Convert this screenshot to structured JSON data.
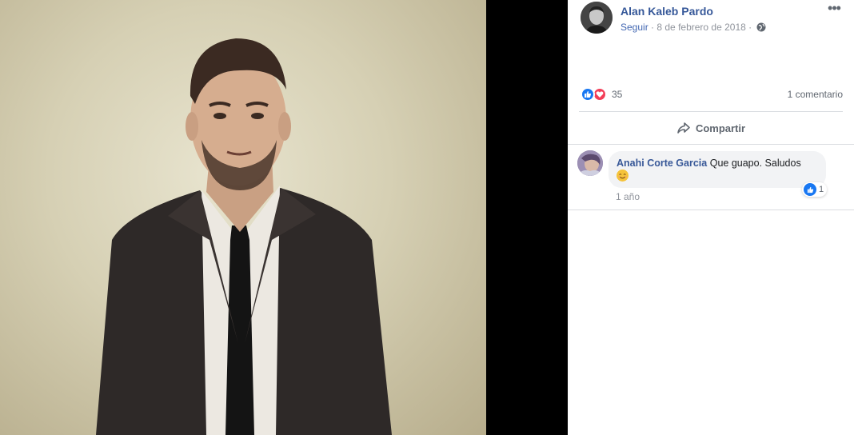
{
  "post": {
    "author_name": "Alan Kaleb Pardo",
    "follow_label": "Seguir",
    "separator": "·",
    "date": "8 de febrero de 2018",
    "privacy_icon": "globe-icon",
    "more_icon": "more-options-icon",
    "more_label": "•••"
  },
  "reactions": {
    "icons": [
      "like-icon",
      "love-icon"
    ],
    "count": "35",
    "comment_count": "1 comentario"
  },
  "actions": {
    "share_label": "Compartir"
  },
  "comments": [
    {
      "author": "Anahi Corte Garcia",
      "text": "Que guapo. Saludos",
      "emoji": "smiling-face-icon",
      "reaction_count": "1",
      "time": "1 año"
    }
  ],
  "colors": {
    "link_blue": "#365899",
    "accent_blue": "#4267b2",
    "like_blue": "#1877f2",
    "love_red": "#f33e58",
    "muted_gray": "#90949c"
  }
}
